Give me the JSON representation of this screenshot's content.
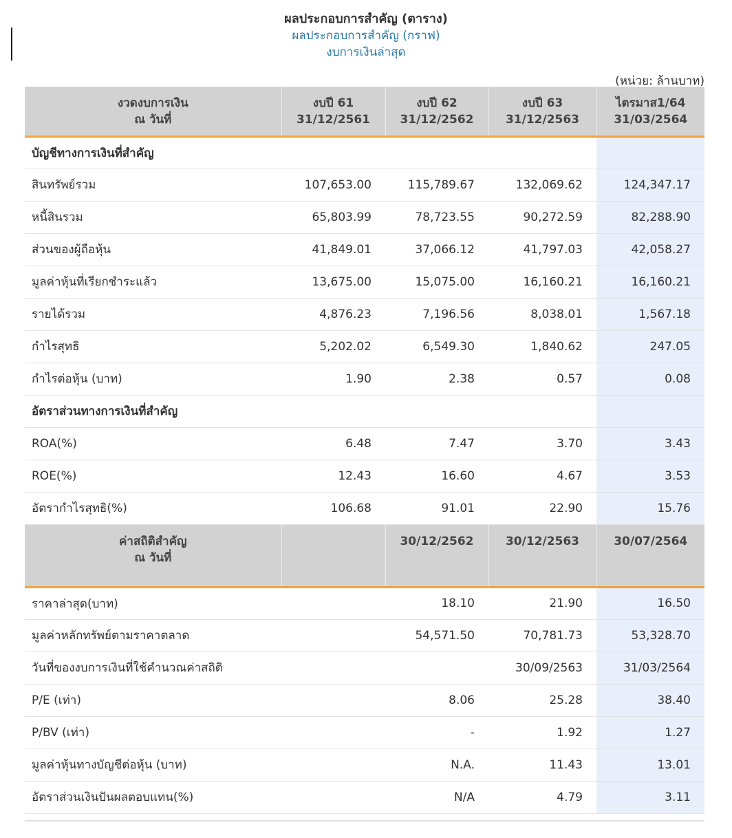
{
  "titles": {
    "main": "ผลประกอบการสำคัญ (ตาราง)",
    "graph_link": "ผลประกอบการสำคัญ (กราฟ)",
    "latest_link": "งบการเงินล่าสุด"
  },
  "unit": "(หน่วย: ล้านบาท)",
  "header": {
    "label_line1": "งวดงบการเงิน",
    "label_line2": "ณ วันที่",
    "cols": [
      {
        "line1": "งบปี 61",
        "line2": "31/12/2561"
      },
      {
        "line1": "งบปี 62",
        "line2": "31/12/2562"
      },
      {
        "line1": "งบปี 63",
        "line2": "31/12/2563"
      },
      {
        "line1": "ไตรมาส1/64",
        "line2": "31/03/2564"
      }
    ]
  },
  "section1": "บัญชีทางการเงินที่สำคัญ",
  "rows1": [
    {
      "label": "สินทรัพย์รวม",
      "v": [
        "107,653.00",
        "115,789.67",
        "132,069.62",
        "124,347.17"
      ]
    },
    {
      "label": "หนี้สินรวม",
      "v": [
        "65,803.99",
        "78,723.55",
        "90,272.59",
        "82,288.90"
      ]
    },
    {
      "label": "ส่วนของผู้ถือหุ้น",
      "v": [
        "41,849.01",
        "37,066.12",
        "41,797.03",
        "42,058.27"
      ]
    },
    {
      "label": "มูลค่าหุ้นที่เรียกชำระแล้ว",
      "v": [
        "13,675.00",
        "15,075.00",
        "16,160.21",
        "16,160.21"
      ]
    },
    {
      "label": "รายได้รวม",
      "v": [
        "4,876.23",
        "7,196.56",
        "8,038.01",
        "1,567.18"
      ]
    },
    {
      "label": "กำไรสุทธิ",
      "v": [
        "5,202.02",
        "6,549.30",
        "1,840.62",
        "247.05"
      ]
    },
    {
      "label": "กำไรต่อหุ้น (บาท)",
      "v": [
        "1.90",
        "2.38",
        "0.57",
        "0.08"
      ]
    }
  ],
  "section2": "อัตราส่วนทางการเงินที่สำคัญ",
  "rows2": [
    {
      "label": "ROA(%)",
      "v": [
        "6.48",
        "7.47",
        "3.70",
        "3.43"
      ]
    },
    {
      "label": "ROE(%)",
      "v": [
        "12.43",
        "16.60",
        "4.67",
        "3.53"
      ]
    },
    {
      "label": "อัตรากำไรสุทธิ(%)",
      "v": [
        "106.68",
        "91.01",
        "22.90",
        "15.76"
      ]
    }
  ],
  "header2": {
    "label_line1": "ค่าสถิติสำคัญ",
    "label_line2": "ณ วันที่",
    "cols": [
      "",
      "30/12/2562",
      "30/12/2563",
      "30/07/2564"
    ]
  },
  "rows3": [
    {
      "label": "ราคาล่าสุด(บาท)",
      "v": [
        "",
        "18.10",
        "21.90",
        "16.50"
      ]
    },
    {
      "label": "มูลค่าหลักทรัพย์ตามราคาตลาด",
      "v": [
        "",
        "54,571.50",
        "70,781.73",
        "53,328.70"
      ]
    },
    {
      "label": "วันที่ของงบการเงินที่ใช้คำนวณค่าสถิติ",
      "v": [
        "",
        "",
        "30/09/2563",
        "31/03/2564"
      ]
    },
    {
      "label": "P/E (เท่า)",
      "v": [
        "",
        "8.06",
        "25.28",
        "38.40"
      ]
    },
    {
      "label": "P/BV (เท่า)",
      "v": [
        "",
        "-",
        "1.92",
        "1.27"
      ]
    },
    {
      "label": "มูลค่าหุ้นทางบัญชีต่อหุ้น (บาท)",
      "v": [
        "",
        "N.A.",
        "11.43",
        "13.01"
      ]
    },
    {
      "label": "อัตราส่วนเงินปันผลตอบแทน(%)",
      "v": [
        "",
        "N/A",
        "4.79",
        "3.11"
      ]
    }
  ]
}
